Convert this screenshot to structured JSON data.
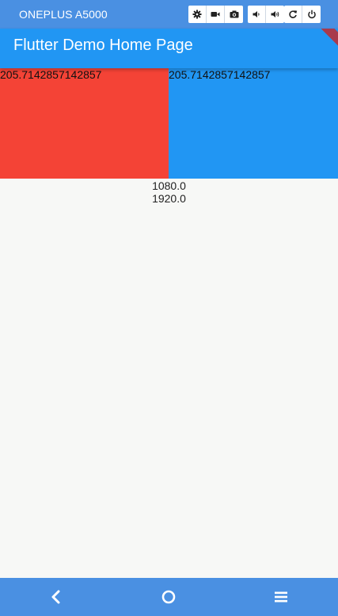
{
  "emulator": {
    "device_name": "ONEPLUS A5000",
    "controls": [
      {
        "icon": "gear-icon"
      },
      {
        "icon": "video-camera-icon"
      },
      {
        "icon": "camera-icon"
      },
      {
        "icon": "volume-down-icon"
      },
      {
        "icon": "volume-up-icon"
      },
      {
        "icon": "rotate-icon"
      },
      {
        "icon": "power-icon"
      }
    ]
  },
  "app_bar": {
    "title": "Flutter Demo Home Page",
    "color": "#2196f3"
  },
  "boxes": {
    "left": {
      "label": "205.7142857142857",
      "color": "#f44336"
    },
    "right": {
      "label": "205.7142857142857",
      "color": "#2196f3"
    }
  },
  "dimensions": {
    "width": "1080.0",
    "height": "1920.0"
  },
  "nav_bar": {
    "color": "#4a90e2",
    "buttons": [
      {
        "icon": "back-icon"
      },
      {
        "icon": "home-icon"
      },
      {
        "icon": "menu-icon"
      }
    ]
  }
}
